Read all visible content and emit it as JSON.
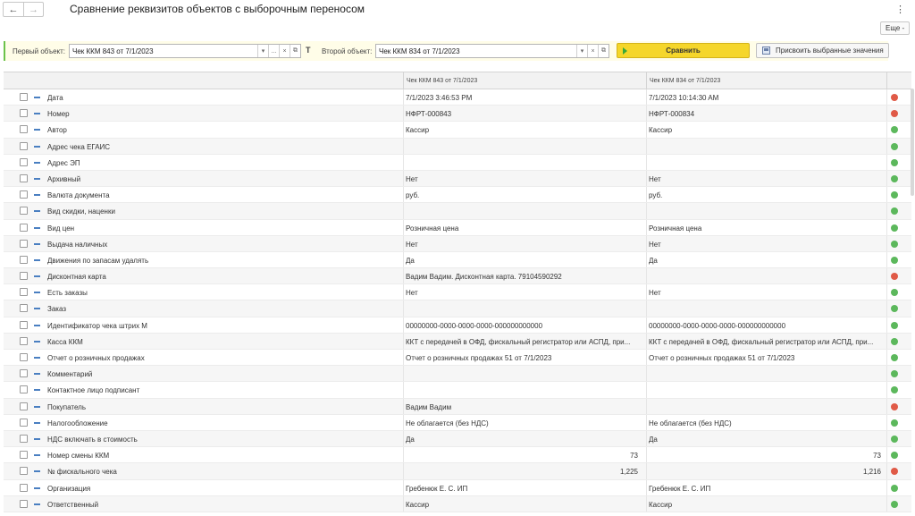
{
  "header": {
    "back_glyph": "←",
    "forward_glyph": "→",
    "title": "Сравнение реквизитов объектов с выборочным переносом",
    "kebab_glyph": "⋮",
    "more_label": "Еще -"
  },
  "toolbar": {
    "first_label": "Первый объект:",
    "first_value": "Чек ККМ 843 от 7/1/2023",
    "swap_glyph": "T",
    "second_label": "Второй объект:",
    "second_value": "Чек ККМ 834 от 7/1/2023",
    "field_btn_dropdown": "▾",
    "field_btn_select": "...",
    "field_btn_clear": "×",
    "field_btn_open": "⧉",
    "compare_label": "Сравнить",
    "assign_label": "Присвоить выбранные значения"
  },
  "table": {
    "headers": {
      "col1": "Чек ККМ 843 от 7/1/2023",
      "col2": "Чек ККМ 834 от 7/1/2023"
    },
    "rows": [
      {
        "name": "Дата",
        "v1": "7/1/2023 3:46:53 PM",
        "v2": "7/1/2023 10:14:30 AM",
        "status": "red"
      },
      {
        "name": "Номер",
        "v1": "НФРТ-000843",
        "v2": "НФРТ-000834",
        "status": "red"
      },
      {
        "name": "Автор",
        "v1": "Кассир",
        "v2": "Кассир",
        "status": "green"
      },
      {
        "name": "Адрес чека ЕГАИС",
        "v1": "",
        "v2": "",
        "status": "green"
      },
      {
        "name": "Адрес ЭП",
        "v1": "",
        "v2": "",
        "status": "green"
      },
      {
        "name": "Архивный",
        "v1": "Нет",
        "v2": "Нет",
        "status": "green"
      },
      {
        "name": "Валюта документа",
        "v1": "руб.",
        "v2": "руб.",
        "status": "green"
      },
      {
        "name": "Вид скидки, наценки",
        "v1": "",
        "v2": "",
        "status": "green"
      },
      {
        "name": "Вид цен",
        "v1": "Розничная цена",
        "v2": "Розничная цена",
        "status": "green"
      },
      {
        "name": "Выдача наличных",
        "v1": "Нет",
        "v2": "Нет",
        "status": "green"
      },
      {
        "name": "Движения по запасам удалять",
        "v1": "Да",
        "v2": "Да",
        "status": "green"
      },
      {
        "name": "Дисконтная карта",
        "v1": "Вадим Вадим. Дисконтная карта. 79104590292",
        "v2": "",
        "status": "red"
      },
      {
        "name": "Есть заказы",
        "v1": "Нет",
        "v2": "Нет",
        "status": "green"
      },
      {
        "name": "Заказ",
        "v1": "",
        "v2": "",
        "status": "green"
      },
      {
        "name": "Идентификатор чека штрих М",
        "v1": "00000000-0000-0000-0000-000000000000",
        "v2": "00000000-0000-0000-0000-000000000000",
        "status": "green"
      },
      {
        "name": "Касса ККМ",
        "v1": "ККТ с передачей в ОФД, фискальный регистратор или АСПД, при...",
        "v2": "ККТ с передачей в ОФД, фискальный регистратор или АСПД, при...",
        "status": "green"
      },
      {
        "name": "Отчет о розничных продажах",
        "v1": "Отчет о розничных продажах 51 от 7/1/2023",
        "v2": "Отчет о розничных продажах 51 от 7/1/2023",
        "status": "green"
      },
      {
        "name": "Комментарий",
        "v1": "",
        "v2": "",
        "status": "green"
      },
      {
        "name": "Контактное лицо подписант",
        "v1": "",
        "v2": "",
        "status": "green"
      },
      {
        "name": "Покупатель",
        "v1": "Вадим Вадим",
        "v2": "",
        "status": "red"
      },
      {
        "name": "Налогообложение",
        "v1": "Не облагается (без НДС)",
        "v2": "Не облагается (без НДС)",
        "status": "green"
      },
      {
        "name": "НДС включать в стоимость",
        "v1": "Да",
        "v2": "Да",
        "status": "green"
      },
      {
        "name": "Номер смены ККМ",
        "v1": "73",
        "v2": "73",
        "status": "green",
        "numeric": true
      },
      {
        "name": "№ фискального чека",
        "v1": "1,225",
        "v2": "1,216",
        "status": "red",
        "numeric": true
      },
      {
        "name": "Организация",
        "v1": "Гребенюк Е. С. ИП",
        "v2": "Гребенюк Е. С. ИП",
        "status": "green"
      },
      {
        "name": "Ответственный",
        "v1": "Кассир",
        "v2": "Кассир",
        "status": "green"
      }
    ]
  },
  "colors": {
    "status_green": "#5cb85c",
    "status_red": "#e05a47",
    "compare_button": "#f5d62a",
    "toolbar_background": "#fffde8",
    "toolbar_accent": "#6cc24a"
  }
}
